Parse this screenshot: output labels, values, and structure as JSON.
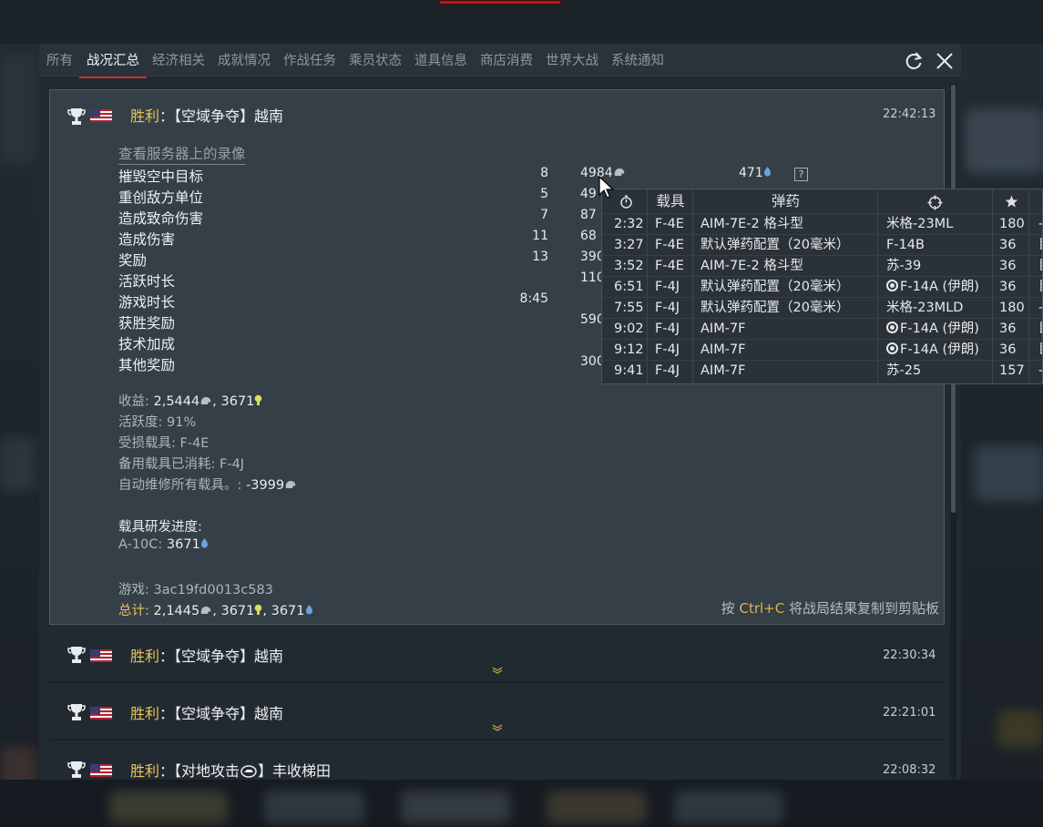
{
  "tabs": [
    {
      "label": "所有"
    },
    {
      "label": "战况汇总"
    },
    {
      "label": "经济相关"
    },
    {
      "label": "成就情况"
    },
    {
      "label": "作战任务"
    },
    {
      "label": "乘员状态"
    },
    {
      "label": "道具信息"
    },
    {
      "label": "商店消费"
    },
    {
      "label": "世界大战"
    },
    {
      "label": "系统通知"
    }
  ],
  "active_tab": "战况汇总",
  "entry_open": {
    "result": "胜利",
    "separator": "：",
    "mission": "【空域争夺】越南",
    "time": "22:42:13",
    "replay_link": "查看服务器上的录像",
    "stats": [
      {
        "label": "摧毁空中目标",
        "count": "8",
        "value": "4984",
        "rp": "471"
      },
      {
        "label": "重创敌方单位",
        "count": "5",
        "value": "49",
        "rp": ""
      },
      {
        "label": "造成致命伤害",
        "count": "7",
        "value": "87",
        "rp": ""
      },
      {
        "label": "造成伤害",
        "count": "11",
        "value": "68",
        "rp": ""
      },
      {
        "label": "奖励",
        "count": "13",
        "value": "390",
        "rp": ""
      },
      {
        "label": "活跃时长",
        "count": "",
        "value": "110",
        "rp": ""
      },
      {
        "label": "游戏时长",
        "count": "8:45",
        "value": "",
        "rp": ""
      },
      {
        "label": "获胜奖励",
        "count": "",
        "value": "590",
        "rp": ""
      },
      {
        "label": "技术加成",
        "count": "",
        "value": "",
        "rp": ""
      },
      {
        "label": "其他奖励",
        "count": "",
        "value": "300",
        "rp": ""
      }
    ],
    "help_glyph": "?",
    "earnings_label": "收益",
    "earnings_sl": "2,5444",
    "earnings_rp": "3671",
    "activity_label": "活跃度",
    "activity_value": "91%",
    "damaged_label": "受损载具",
    "damaged_value": "F-4E",
    "backup_label": "备用载具已消耗",
    "backup_value": "F-4J",
    "repair_label": "自动维修所有载具。",
    "repair_value": "-3999",
    "research_title": "载具研发进度",
    "research_vehicle": "A-10C",
    "research_value": "3671",
    "game_label": "游戏",
    "game_id": "3ac19fd0013c583",
    "total_label": "总计",
    "total_sl": "2,1445",
    "total_rp1": "3671",
    "total_rp2": "3671",
    "copy_hint_pre": "按",
    "copy_hint_key": "Ctrl+C",
    "copy_hint_post": "将战局结果复制到剪贴板"
  },
  "entries": [
    {
      "result": "胜利",
      "separator": "：",
      "mission": "【空域争夺】越南",
      "time": "22:30:34"
    },
    {
      "result": "胜利",
      "separator": "：",
      "mission": "【空域争夺】越南",
      "time": "22:21:01"
    },
    {
      "result": "胜利",
      "separator": "：",
      "mission_pre": "【对地攻击",
      "mission_post": "】丰收梯田",
      "time": "22:08:32"
    }
  ],
  "tooltip": {
    "headers": {
      "vehicle": "载具",
      "ammo": "弹药"
    },
    "rows": [
      {
        "time": "2:32",
        "vehicle": "F-4E",
        "ammo": "AIM-7E-2 格斗型",
        "target": "米格-23ML",
        "target_marked": false,
        "points": "180",
        "extra": "-"
      },
      {
        "time": "3:27",
        "vehicle": "F-4E",
        "ammo": "默认弹药配置（20毫米）",
        "target": "F-14B",
        "target_marked": false,
        "points": "36",
        "extra": "目"
      },
      {
        "time": "3:52",
        "vehicle": "F-4E",
        "ammo": "AIM-7E-2 格斗型",
        "target": "苏-39",
        "target_marked": false,
        "points": "36",
        "extra": "目"
      },
      {
        "time": "6:51",
        "vehicle": "F-4J",
        "ammo": "默认弹药配置（20毫米）",
        "target": "F-14A (伊朗)",
        "target_marked": true,
        "points": "36",
        "extra": "目"
      },
      {
        "time": "7:55",
        "vehicle": "F-4J",
        "ammo": "默认弹药配置（20毫米）",
        "target": "米格-23MLD",
        "target_marked": false,
        "points": "180",
        "extra": "-"
      },
      {
        "time": "9:02",
        "vehicle": "F-4J",
        "ammo": "AIM-7F",
        "target": "F-14A (伊朗)",
        "target_marked": true,
        "points": "36",
        "extra": "目"
      },
      {
        "time": "9:12",
        "vehicle": "F-4J",
        "ammo": "AIM-7F",
        "target": "F-14A (伊朗)",
        "target_marked": true,
        "points": "36",
        "extra": "目"
      },
      {
        "time": "9:41",
        "vehicle": "F-4J",
        "ammo": "AIM-7F",
        "target": "苏-25",
        "target_marked": false,
        "points": "157",
        "extra": "-"
      }
    ]
  },
  "colors": {
    "accent_red": "#c8322b",
    "win_gold": "#e7c45a",
    "silver_lions": "#b9bec3",
    "rp_bulb": "#d9e05a",
    "rp_drop": "#6f9fe0"
  },
  "icons": [
    "refresh-icon",
    "close-icon",
    "trophy-icon",
    "us-flag-icon",
    "silver-lion-icon",
    "bulb-icon",
    "drop-icon",
    "timer-icon",
    "crosshair-icon",
    "star-icon",
    "chevron-down-icon",
    "mouse-cursor-icon"
  ]
}
